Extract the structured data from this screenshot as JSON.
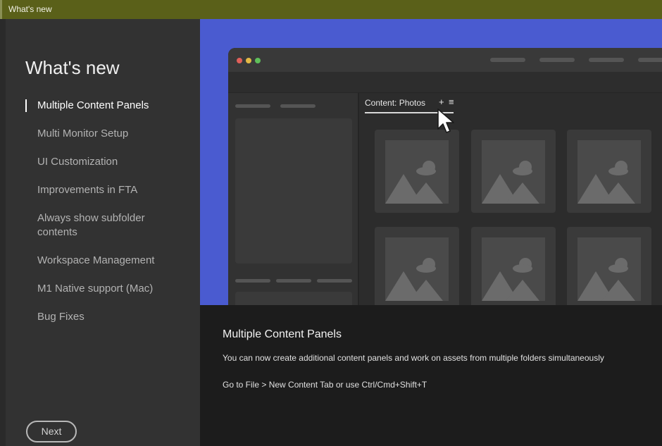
{
  "window": {
    "title": "What's new"
  },
  "sidebar": {
    "heading": "What's new",
    "items": [
      {
        "label": "Multiple Content Panels",
        "active": true
      },
      {
        "label": "Multi Monitor Setup"
      },
      {
        "label": "UI Customization"
      },
      {
        "label": "Improvements in FTA"
      },
      {
        "label": "Always show subfolder contents"
      },
      {
        "label": "Workspace Management"
      },
      {
        "label": "M1 Native support (Mac)"
      },
      {
        "label": "Bug Fixes"
      }
    ],
    "next_label": "Next"
  },
  "hero": {
    "content_tab_label": "Content: Photos",
    "plus_glyph": "+",
    "menu_glyph": "≡"
  },
  "detail": {
    "title": "Multiple Content Panels",
    "body": "You can now create additional content panels and work on assets from multiple folders simultaneously",
    "shortcut": "Go to File > New Content Tab or use Ctrl/Cmd+Shift+T"
  },
  "colors": {
    "titlebar": "#5a6019",
    "hero_background": "#4a5bd0",
    "sidebar": "#323232",
    "detail_background": "#1c1c1c"
  },
  "icons": [
    "image-placeholder-icon",
    "mouse-cursor-icon",
    "plus-icon",
    "hamburger-menu-icon"
  ]
}
